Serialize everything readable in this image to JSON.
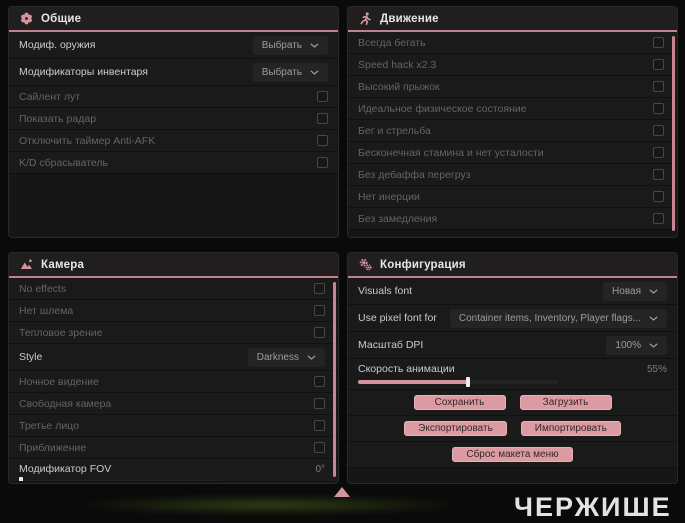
{
  "accent_color": "#d4949e",
  "watermark": "ЧЕРЖИШЕ",
  "panels": [
    {
      "id": "general",
      "title": "Общие",
      "icon": "flower-icon",
      "scrollbar": false,
      "rows": [
        {
          "label": "Модиф. оружия",
          "bright": true,
          "control": {
            "type": "dropdown",
            "value": "Выбрать"
          }
        },
        {
          "label": "Модификаторы инвентаря",
          "bright": true,
          "control": {
            "type": "dropdown",
            "value": "Выбрать"
          }
        },
        {
          "label": "Сайлент лут",
          "bright": false,
          "control": {
            "type": "checkbox",
            "checked": false
          }
        },
        {
          "label": "Показать радар",
          "bright": false,
          "control": {
            "type": "checkbox",
            "checked": false
          }
        },
        {
          "label": "Отключить таймер Anti-AFK",
          "bright": false,
          "control": {
            "type": "checkbox",
            "checked": false
          }
        },
        {
          "label": "K/D сбрасыватель",
          "bright": false,
          "control": {
            "type": "checkbox",
            "checked": false
          }
        }
      ]
    },
    {
      "id": "movement",
      "title": "Движение",
      "icon": "runner-icon",
      "scrollbar": true,
      "rows": [
        {
          "label": "Всегда бегать",
          "bright": false,
          "control": {
            "type": "checkbox",
            "checked": false
          }
        },
        {
          "label": "Speed hack x2.3",
          "bright": false,
          "control": {
            "type": "checkbox",
            "checked": false
          }
        },
        {
          "label": "Высокий прыжок",
          "bright": false,
          "control": {
            "type": "checkbox",
            "checked": false
          }
        },
        {
          "label": "Идеальное физическое состояние",
          "bright": false,
          "control": {
            "type": "checkbox",
            "checked": false
          }
        },
        {
          "label": "Бег и стрельба",
          "bright": false,
          "control": {
            "type": "checkbox",
            "checked": false
          }
        },
        {
          "label": "Бесконечная стамина и нет усталости",
          "bright": false,
          "control": {
            "type": "checkbox",
            "checked": false
          }
        },
        {
          "label": "Без дебаффа перегруз",
          "bright": false,
          "control": {
            "type": "checkbox",
            "checked": false
          }
        },
        {
          "label": "Нет инерции",
          "bright": false,
          "control": {
            "type": "checkbox",
            "checked": false
          }
        },
        {
          "label": "Без замедления",
          "bright": false,
          "control": {
            "type": "checkbox",
            "checked": false
          }
        }
      ]
    },
    {
      "id": "camera",
      "title": "Камера",
      "icon": "image-icon",
      "scrollbar": true,
      "rows": [
        {
          "label": "No effects",
          "bright": false,
          "control": {
            "type": "checkbox",
            "checked": false
          }
        },
        {
          "label": "Нет шлема",
          "bright": false,
          "control": {
            "type": "checkbox",
            "checked": false
          }
        },
        {
          "label": "Тепловое зрение",
          "bright": false,
          "control": {
            "type": "checkbox",
            "checked": false
          }
        },
        {
          "label": "Style",
          "bright": true,
          "control": {
            "type": "dropdown",
            "value": "Darkness"
          }
        },
        {
          "label": "Ночное видение",
          "bright": false,
          "control": {
            "type": "checkbox",
            "checked": false
          }
        },
        {
          "label": "Свободная камера",
          "bright": false,
          "control": {
            "type": "checkbox",
            "checked": false
          }
        },
        {
          "label": "Третье лицо",
          "bright": false,
          "control": {
            "type": "checkbox",
            "checked": false
          }
        },
        {
          "label": "Приближение",
          "bright": false,
          "control": {
            "type": "checkbox",
            "checked": false
          }
        },
        {
          "label": "Модификатор FOV",
          "bright": true,
          "control": {
            "type": "slider",
            "value_label": "0°",
            "percent": 0
          }
        }
      ]
    },
    {
      "id": "config",
      "title": "Конфигурация",
      "icon": "gears-icon",
      "scrollbar": false,
      "rows": [
        {
          "label": "Visuals font",
          "bright": true,
          "control": {
            "type": "dropdown",
            "value": "Новая"
          }
        },
        {
          "label": "Use pixel font for",
          "bright": true,
          "control": {
            "type": "dropdown",
            "value": "Container items, Inventory, Player flags..."
          }
        },
        {
          "label": "Масштаб DPI",
          "bright": true,
          "control": {
            "type": "dropdown",
            "value": "100%"
          }
        },
        {
          "label": "Скорость анимации",
          "bright": true,
          "control": {
            "type": "slider",
            "value_label": "55%",
            "percent": 55
          }
        },
        {
          "control": {
            "type": "buttons",
            "buttons": [
              {
                "name": "save-button",
                "label": "Сохранить"
              },
              {
                "name": "load-button",
                "label": "Загрузить"
              }
            ]
          }
        },
        {
          "control": {
            "type": "buttons",
            "buttons": [
              {
                "name": "export-button",
                "label": "Экспортировать"
              },
              {
                "name": "import-button",
                "label": "Импортировать"
              }
            ]
          }
        },
        {
          "control": {
            "type": "buttons",
            "buttons": [
              {
                "name": "reset-menu-layout-button",
                "label": "Сброс макета меню"
              }
            ]
          }
        }
      ]
    }
  ]
}
